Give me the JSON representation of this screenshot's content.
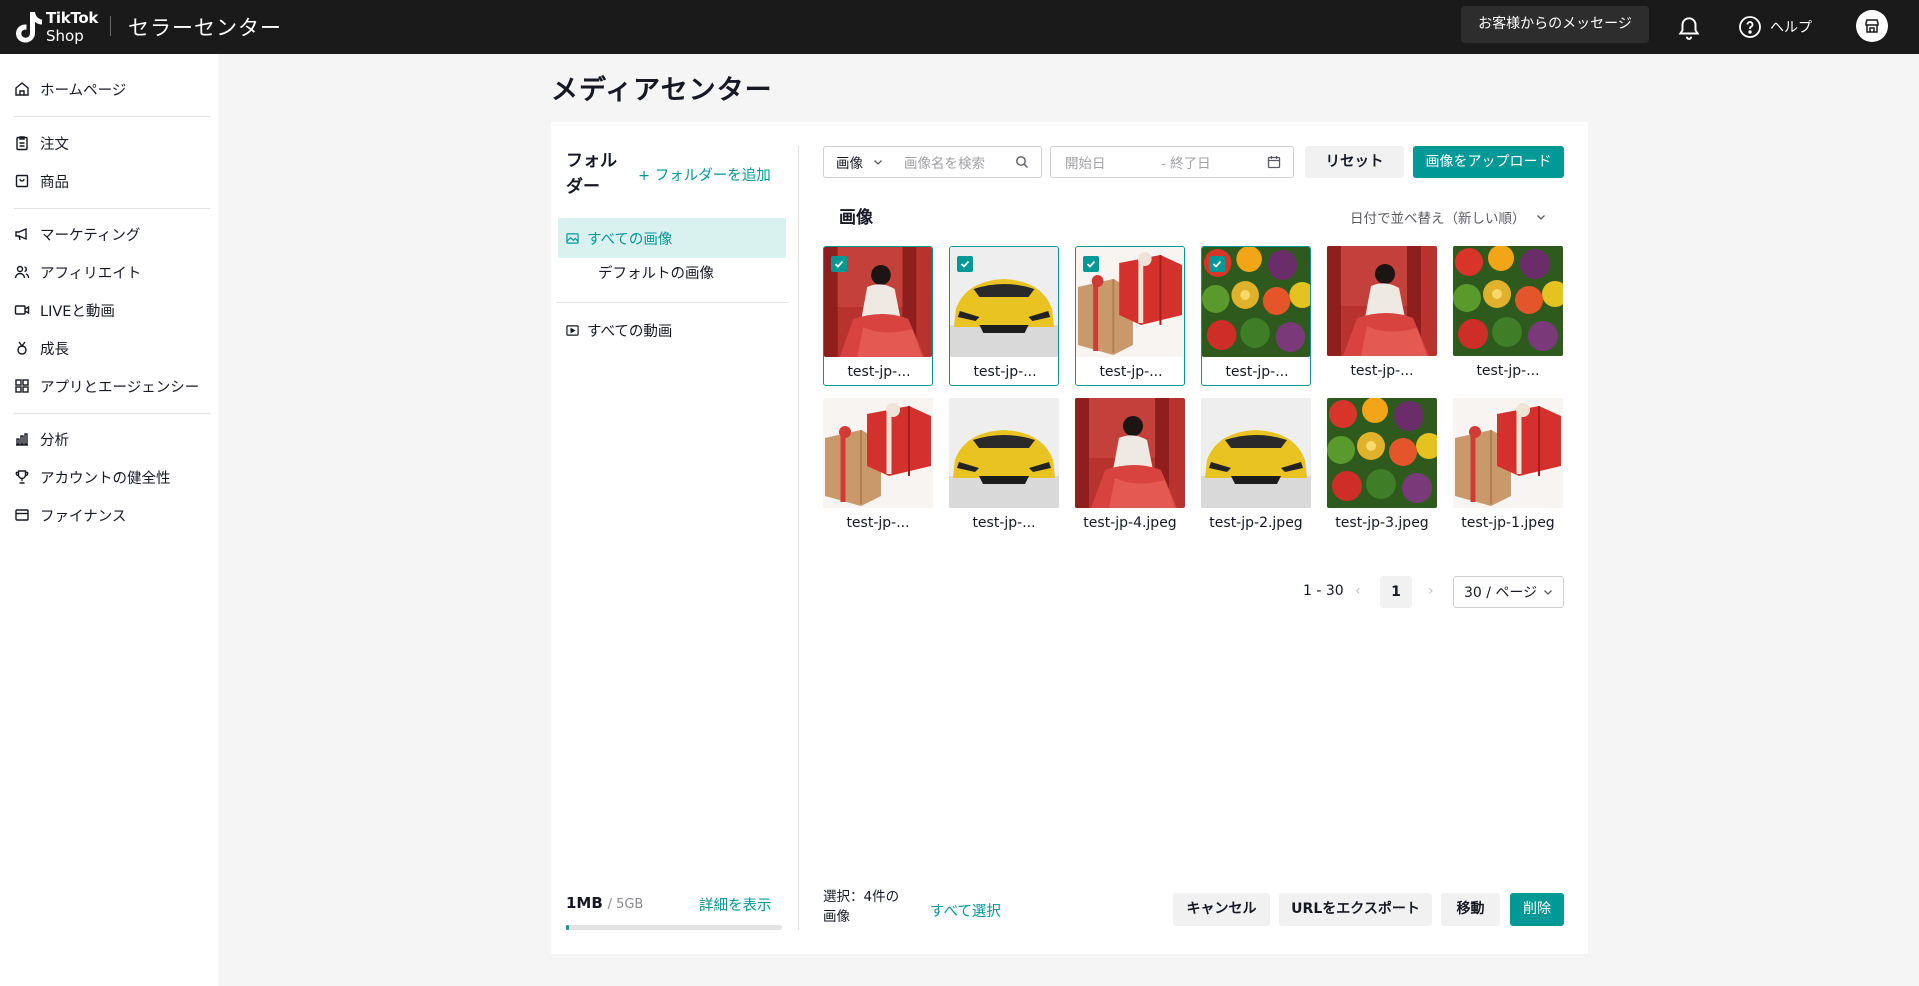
{
  "topbar": {
    "logo_line1": "TikTok",
    "logo_line2": "Shop",
    "title": "セラーセンター",
    "messages": "お客様からのメッセージ",
    "help": "ヘルプ"
  },
  "sidebar": {
    "items": [
      {
        "label": "ホームページ",
        "icon": "home-icon"
      },
      {
        "label": "注文",
        "icon": "clipboard-icon"
      },
      {
        "label": "商品",
        "icon": "box-icon"
      },
      {
        "label": "マーケティング",
        "icon": "megaphone-icon"
      },
      {
        "label": "アフィリエイト",
        "icon": "users-icon"
      },
      {
        "label": "LIVEと動画",
        "icon": "video-icon"
      },
      {
        "label": "成長",
        "icon": "medal-icon"
      },
      {
        "label": "アプリとエージェンシー",
        "icon": "apps-icon"
      },
      {
        "label": "分析",
        "icon": "chart-icon"
      },
      {
        "label": "アカウントの健全性",
        "icon": "trophy-icon"
      },
      {
        "label": "ファイナンス",
        "icon": "wallet-icon"
      }
    ]
  },
  "page": {
    "title": "メディアセンター"
  },
  "folders": {
    "heading": "フォルダー",
    "add": "+ フォルダーを追加",
    "all_images": "すべての画像",
    "default_images": "デフォルトの画像",
    "all_videos": "すべての動画"
  },
  "storage": {
    "used": "1MB",
    "total": "/ 5GB",
    "detail": "詳細を表示",
    "fraction": 0.0002
  },
  "toolbar": {
    "type": "画像",
    "search_placeholder": "画像名を検索",
    "date_start": "開始日",
    "date_end": "- 終了日",
    "reset": "リセット",
    "upload": "画像をアップロード"
  },
  "gallery": {
    "title": "画像",
    "sort": "日付で並べ替え（新しい順）",
    "items": [
      {
        "label": "test-jp-...",
        "img": "woman",
        "selected": true
      },
      {
        "label": "test-jp-...",
        "img": "car",
        "selected": true
      },
      {
        "label": "test-jp-...",
        "img": "gift",
        "selected": true
      },
      {
        "label": "test-jp-...",
        "img": "veg",
        "selected": true
      },
      {
        "label": "test-jp-...",
        "img": "woman",
        "selected": false
      },
      {
        "label": "test-jp-...",
        "img": "veg",
        "selected": false
      },
      {
        "label": "test-jp-...",
        "img": "gift",
        "selected": false
      },
      {
        "label": "test-jp-...",
        "img": "car",
        "selected": false
      },
      {
        "label": "test-jp-4.jpeg",
        "img": "woman",
        "selected": false
      },
      {
        "label": "test-jp-2.jpeg",
        "img": "car",
        "selected": false
      },
      {
        "label": "test-jp-3.jpeg",
        "img": "veg",
        "selected": false
      },
      {
        "label": "test-jp-1.jpeg",
        "img": "gift",
        "selected": false
      }
    ]
  },
  "pagination": {
    "range": "1 - 30",
    "prev": "‹",
    "page": "1",
    "next": "›",
    "size": "30 / ページ"
  },
  "footer": {
    "selected_count": "選択：4件の画像",
    "select_all": "すべて選択",
    "cancel": "キャンセル",
    "export": "URLをエクスポート",
    "move": "移動",
    "delete": "削除"
  },
  "colors": {
    "accent": "#009995",
    "topbar": "#1a1a1a"
  }
}
